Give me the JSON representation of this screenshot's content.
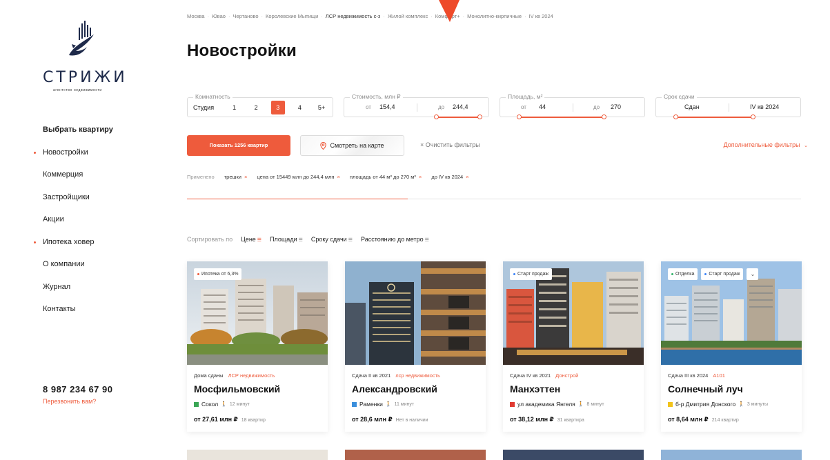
{
  "brand": {
    "name": "СТРИЖИ",
    "tagline": "агентство недвижимости"
  },
  "nav": [
    {
      "label": "Выбрать квартиру",
      "bold": true,
      "dot": false
    },
    {
      "label": "Новостройки",
      "bold": false,
      "dot": true
    },
    {
      "label": "Коммерция",
      "bold": false,
      "dot": false
    },
    {
      "label": "Застройщики",
      "bold": false,
      "dot": false
    },
    {
      "label": "Акции",
      "bold": false,
      "dot": false
    },
    {
      "label": "Ипотека ховер",
      "bold": false,
      "dot": true
    },
    {
      "label": "О компании",
      "bold": false,
      "dot": false
    },
    {
      "label": "Журнал",
      "bold": false,
      "dot": false
    },
    {
      "label": "Контакты",
      "bold": false,
      "dot": false
    }
  ],
  "contact": {
    "phone": "8 987 234 67 90",
    "callback": "Перезвонить вам?"
  },
  "breadcrumbs": [
    {
      "label": "Москва",
      "dark": false
    },
    {
      "label": "Ювао",
      "dark": false
    },
    {
      "label": "Чертаново",
      "dark": false
    },
    {
      "label": "Королевские Мытищи",
      "dark": false
    },
    {
      "label": "ЛСР недвижимость с-з",
      "dark": true
    },
    {
      "label": "Жилой комплекс",
      "dark": false
    },
    {
      "label": "Комфорт+",
      "dark": false
    },
    {
      "label": "Монолитно-кирпичные",
      "dark": false
    },
    {
      "label": "IV кв 2024",
      "dark": false
    }
  ],
  "page_title": "Новостройки",
  "filters": {
    "rooms": {
      "label": "Комнатность",
      "options": [
        "Студия",
        "1",
        "2",
        "3",
        "4",
        "5+"
      ],
      "selected": "3"
    },
    "cost": {
      "label": "Стоимость, млн ₽",
      "from_label": "от",
      "from": "154,4",
      "to_label": "до",
      "to": "244,4"
    },
    "area": {
      "label": "Площадь, м²",
      "from_label": "от",
      "from": "44",
      "to_label": "до",
      "to": "270"
    },
    "term": {
      "label": "Срок сдачи",
      "from": "Сдан",
      "to": "IV кв 2024"
    }
  },
  "actions": {
    "show": "Показать 1256 квартир",
    "map": "Смотреть на карте",
    "clear": "Очистить фильтры",
    "more": "Дополнительные фильтры"
  },
  "applied": {
    "label": "Применено",
    "chips": [
      "трешки",
      "цена от 15449 млн до 244,4 млн",
      "площадь от 44 м² до 270 м²",
      "до IV кв 2024"
    ]
  },
  "progress": 0.36,
  "sort": {
    "label": "Сортировать по",
    "options": [
      "Цене",
      "Площади",
      "Сроку сдачи",
      "Расстоянию до метро"
    ],
    "active": "Цене"
  },
  "cards": [
    {
      "badges": [
        {
          "text": "Ипотека от 6,3%",
          "dot": "red"
        }
      ],
      "status": "Дома сданы",
      "developer": "ЛСР недвижимость",
      "name": "Мосфильмовский",
      "metro": "Сокол",
      "metro_color": "#3aa655",
      "walk": "12 минут",
      "price": "от 27,61 млн ₽",
      "flats": "18 квартир"
    },
    {
      "badges": [],
      "status": "Сдача II кв 2021",
      "developer": "лср недвижимость",
      "name": "Александровский",
      "metro": "Раменки",
      "metro_color": "#3b8fdc",
      "walk": "11 минут",
      "price": "от 28,6 млн ₽",
      "flats": "Нет в наличии"
    },
    {
      "badges": [
        {
          "text": "Старт продаж",
          "dot": "blue"
        }
      ],
      "status": "Сдача IV кв 2021",
      "developer": "Донстрой",
      "name": "Манхэттен",
      "metro": "ул академика Янгеля",
      "metro_color": "#e03a32",
      "walk": "8 минут",
      "price": "от 38,12 млн ₽",
      "flats": "31 квартира"
    },
    {
      "badges": [
        {
          "text": "Отделка",
          "dot": "green"
        },
        {
          "text": "Старт продаж",
          "dot": "blue"
        }
      ],
      "status": "Сдача III кв 2024",
      "developer": "А101",
      "name": "Солнечный луч",
      "metro": "б-р Дмитрия Донского",
      "metro_color": "#f2c31b",
      "walk": "3 минуты",
      "price": "от 8,64 млн ₽",
      "flats": "214 квартир"
    }
  ],
  "colors": {
    "accent": "#ee5b3c",
    "text": "#1c1c1c",
    "muted": "#8a8a8a",
    "brand_navy": "#1e2a4a"
  },
  "icons": [
    "logo-bird-icon",
    "map-pin-icon",
    "close-icon",
    "chevron-down-icon",
    "sort-icon",
    "walk-icon"
  ]
}
